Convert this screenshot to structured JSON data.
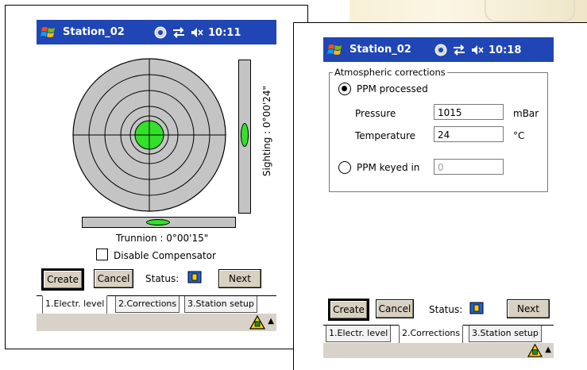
{
  "left_window": {
    "title": "Station_02",
    "time": "10:11",
    "tray_icons": [
      "sync-icon",
      "connectivity-icon",
      "volume-muted-icon"
    ],
    "sighting_label": "Sighting : 0°00'24\"",
    "trunnion_label": "Trunnion : 0°00'15\"",
    "disable_compensator_label": "Disable Compensator",
    "disable_compensator_checked": false,
    "create_label": "Create",
    "cancel_label": "Cancel",
    "status_label": "Status:",
    "next_label": "Next",
    "tabs": [
      {
        "label": "1.Electr. level",
        "active": true
      },
      {
        "label": "2.Corrections",
        "active": false
      },
      {
        "label": "3.Station setup",
        "active": false
      }
    ],
    "colors": {
      "titlebar": "#1f46b4",
      "bubble": "#33e02a",
      "dial": "#c4c4c4"
    }
  },
  "right_window": {
    "title": "Station_02",
    "time": "10:18",
    "group_title": "Atmospheric corrections",
    "ppm_processed_label": "PPM processed",
    "ppm_processed_selected": true,
    "pressure_label": "Pressure",
    "pressure_value": "1015",
    "pressure_unit": "mBar",
    "temperature_label": "Temperature",
    "temperature_value": "24",
    "temperature_unit": "°C",
    "ppm_keyed_label": "PPM keyed in",
    "ppm_keyed_selected": false,
    "ppm_keyed_value": "0",
    "create_label": "Create",
    "cancel_label": "Cancel",
    "status_label": "Status:",
    "next_label": "Next",
    "tabs": [
      {
        "label": "1.Electr. level",
        "active": false
      },
      {
        "label": "2.Corrections",
        "active": true
      },
      {
        "label": "3.Station setup",
        "active": false
      }
    ]
  }
}
